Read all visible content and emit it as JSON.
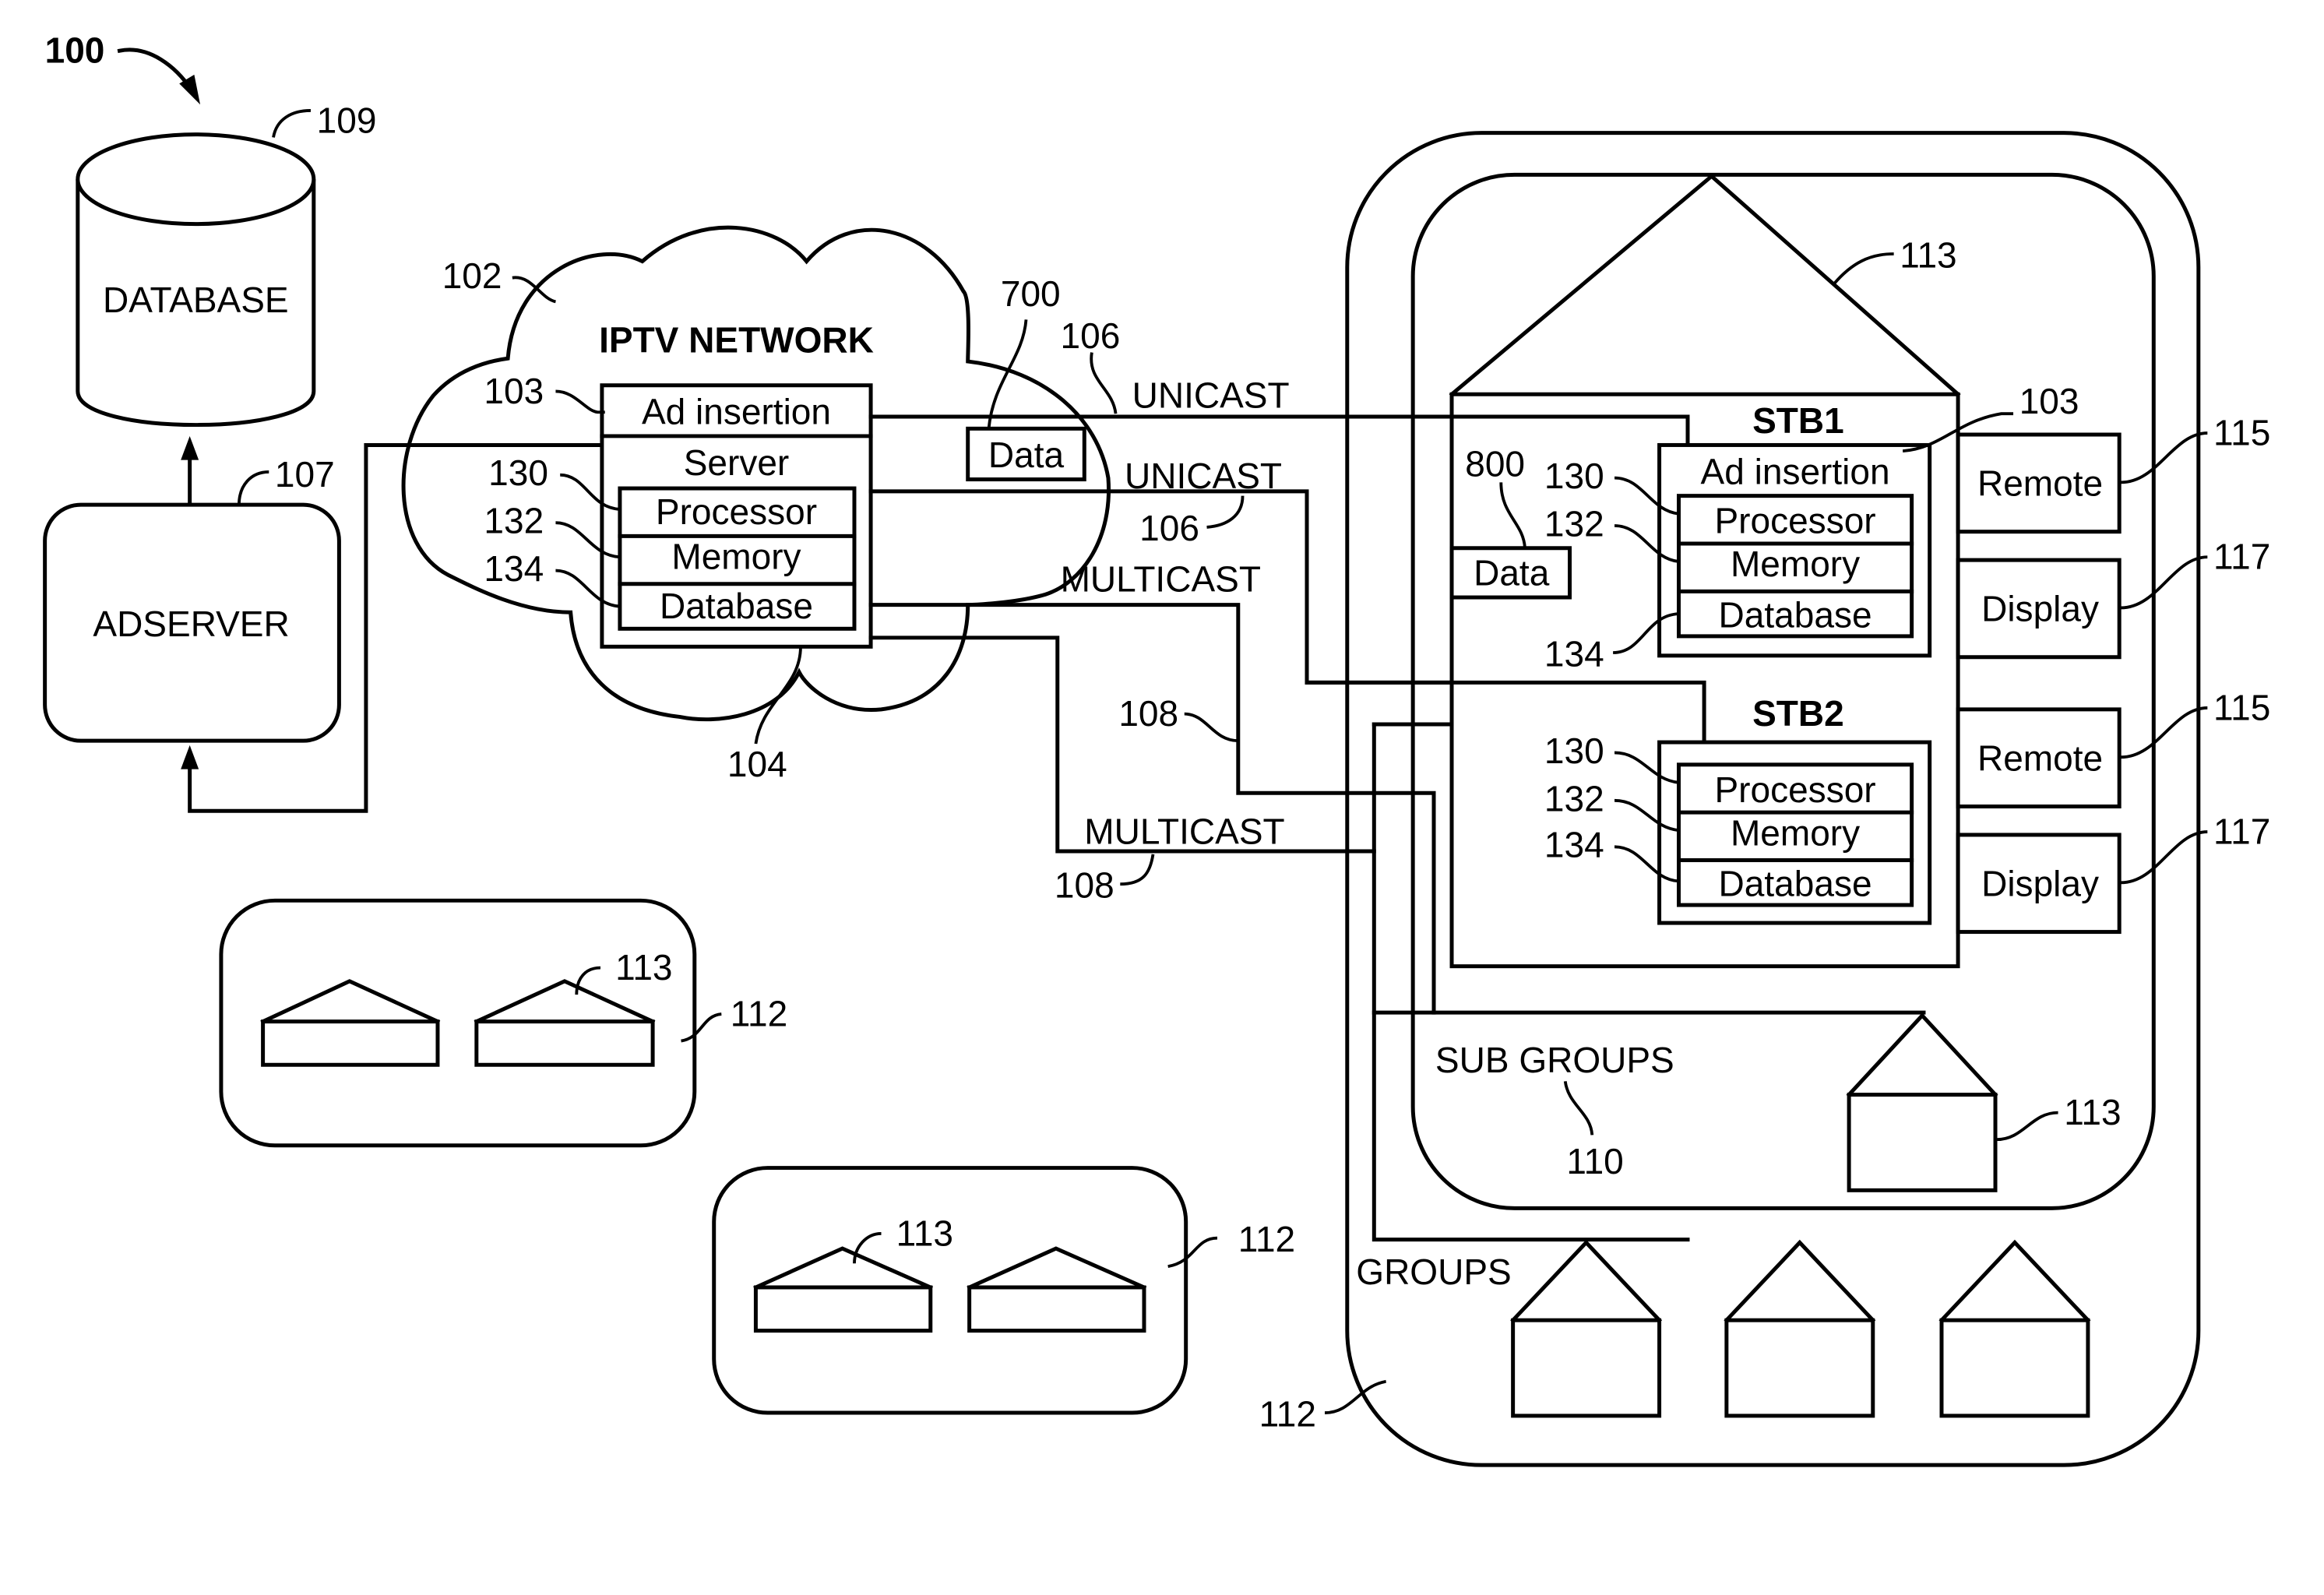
{
  "figure": {
    "number": "100"
  },
  "database": {
    "label": "DATABASE",
    "ref": "109"
  },
  "adserver": {
    "label": "ADSERVER",
    "ref": "107"
  },
  "iptv_network": {
    "title": "IPTV NETWORK",
    "ref": "102",
    "server_ref": "104",
    "server": {
      "ad_insertion": "Ad insertion",
      "ad_insertion_ref": "103",
      "title": "Server",
      "components": [
        {
          "label": "Processor",
          "ref": "130"
        },
        {
          "label": "Memory",
          "ref": "132"
        },
        {
          "label": "Database",
          "ref": "134"
        }
      ]
    },
    "data_box": {
      "label": "Data",
      "ref": "700"
    }
  },
  "links": {
    "unicast_1": {
      "label": "UNICAST",
      "ref": "106"
    },
    "unicast_2": {
      "label": "UNICAST",
      "ref": "106"
    },
    "multicast_1": {
      "label": "MULTICAST",
      "ref": "108"
    },
    "multicast_2": {
      "label": "MULTICAST",
      "ref": "108"
    }
  },
  "home": {
    "ref": "113",
    "data_box": {
      "label": "Data",
      "ref": "800"
    },
    "stb1": {
      "title": "STB1",
      "ad_insertion": "Ad insertion",
      "ad_insertion_ref": "103",
      "components": [
        {
          "label": "Processor",
          "ref": "130"
        },
        {
          "label": "Memory",
          "ref": "132"
        },
        {
          "label": "Database",
          "ref": "134"
        }
      ],
      "remote": {
        "label": "Remote",
        "ref": "115"
      },
      "display": {
        "label": "Display",
        "ref": "117"
      }
    },
    "stb2": {
      "title": "STB2",
      "components": [
        {
          "label": "Processor",
          "ref": "130"
        },
        {
          "label": "Memory",
          "ref": "132"
        },
        {
          "label": "Database",
          "ref": "134"
        }
      ],
      "remote": {
        "label": "Remote",
        "ref": "115"
      },
      "display": {
        "label": "Display",
        "ref": "117"
      }
    }
  },
  "sub_groups": {
    "label": "SUB GROUPS",
    "ref": "110",
    "home_ref": "113"
  },
  "groups": {
    "label": "GROUPS",
    "ref": "112"
  },
  "other_groups": [
    {
      "ref": "112",
      "home_ref": "113"
    },
    {
      "ref": "112",
      "home_ref": "113"
    }
  ]
}
